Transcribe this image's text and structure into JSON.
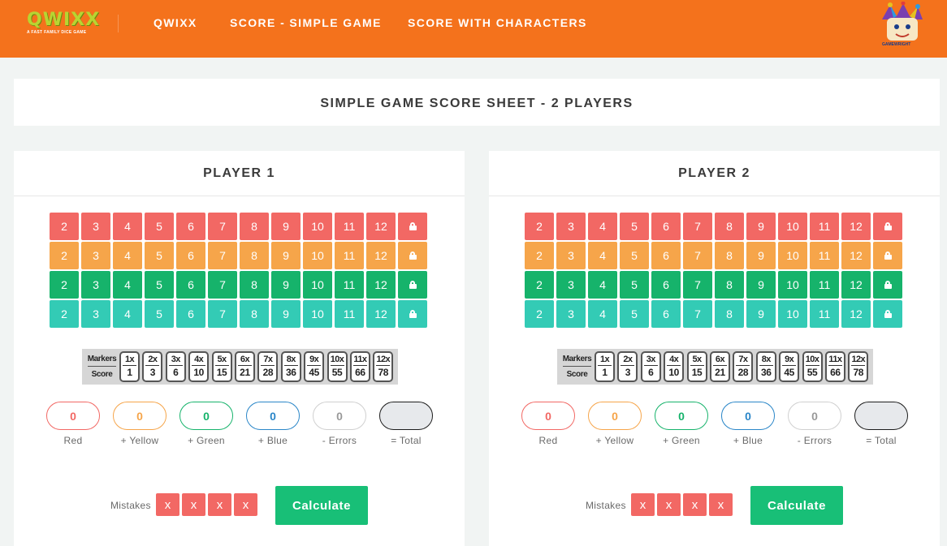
{
  "header": {
    "logo_text": "QWIXX",
    "logo_tagline": "A FAST FAMILY DICE GAME",
    "nav": [
      "QWIXX",
      "SCORE - SIMPLE GAME",
      "SCORE WITH CHARACTERS"
    ],
    "brand_text": "GAMEWRIGHT"
  },
  "page": {
    "title": "SIMPLE GAME SCORE SHEET - 2 PLAYERS"
  },
  "colors": {
    "red": "#f26864",
    "yellow": "#f6a54a",
    "green": "#16b36b",
    "blue": "#33cbb5",
    "accent": "#f4721c",
    "calculate": "#18bf77"
  },
  "grid_rows": [
    {
      "color": "red",
      "numbers": [
        "2",
        "3",
        "4",
        "5",
        "6",
        "7",
        "8",
        "9",
        "10",
        "11",
        "12"
      ]
    },
    {
      "color": "yellow",
      "numbers": [
        "2",
        "3",
        "4",
        "5",
        "6",
        "7",
        "8",
        "9",
        "10",
        "11",
        "12"
      ]
    },
    {
      "color": "green",
      "numbers": [
        "2",
        "3",
        "4",
        "5",
        "6",
        "7",
        "8",
        "9",
        "10",
        "11",
        "12"
      ]
    },
    {
      "color": "blue",
      "numbers": [
        "2",
        "3",
        "4",
        "5",
        "6",
        "7",
        "8",
        "9",
        "10",
        "11",
        "12"
      ]
    }
  ],
  "score_table": {
    "markers_label": "Markers",
    "score_label": "Score",
    "entries": [
      {
        "markers": "1x",
        "score": "1"
      },
      {
        "markers": "2x",
        "score": "3"
      },
      {
        "markers": "3x",
        "score": "6"
      },
      {
        "markers": "4x",
        "score": "10"
      },
      {
        "markers": "5x",
        "score": "15"
      },
      {
        "markers": "6x",
        "score": "21"
      },
      {
        "markers": "7x",
        "score": "28"
      },
      {
        "markers": "8x",
        "score": "36"
      },
      {
        "markers": "9x",
        "score": "45"
      },
      {
        "markers": "10x",
        "score": "55"
      },
      {
        "markers": "11x",
        "score": "66"
      },
      {
        "markers": "12x",
        "score": "78"
      }
    ]
  },
  "score_labels": [
    "Red",
    "+ Yellow",
    "+ Green",
    "+ Blue",
    "- Errors",
    "= Total"
  ],
  "mistakes_label": "Mistakes",
  "mistake_mark": "x",
  "calculate_label": "Calculate",
  "players": [
    {
      "title": "PLAYER 1",
      "scores": [
        "0",
        "0",
        "0",
        "0",
        "0",
        ""
      ]
    },
    {
      "title": "PLAYER 2",
      "scores": [
        "0",
        "0",
        "0",
        "0",
        "0",
        ""
      ]
    }
  ]
}
